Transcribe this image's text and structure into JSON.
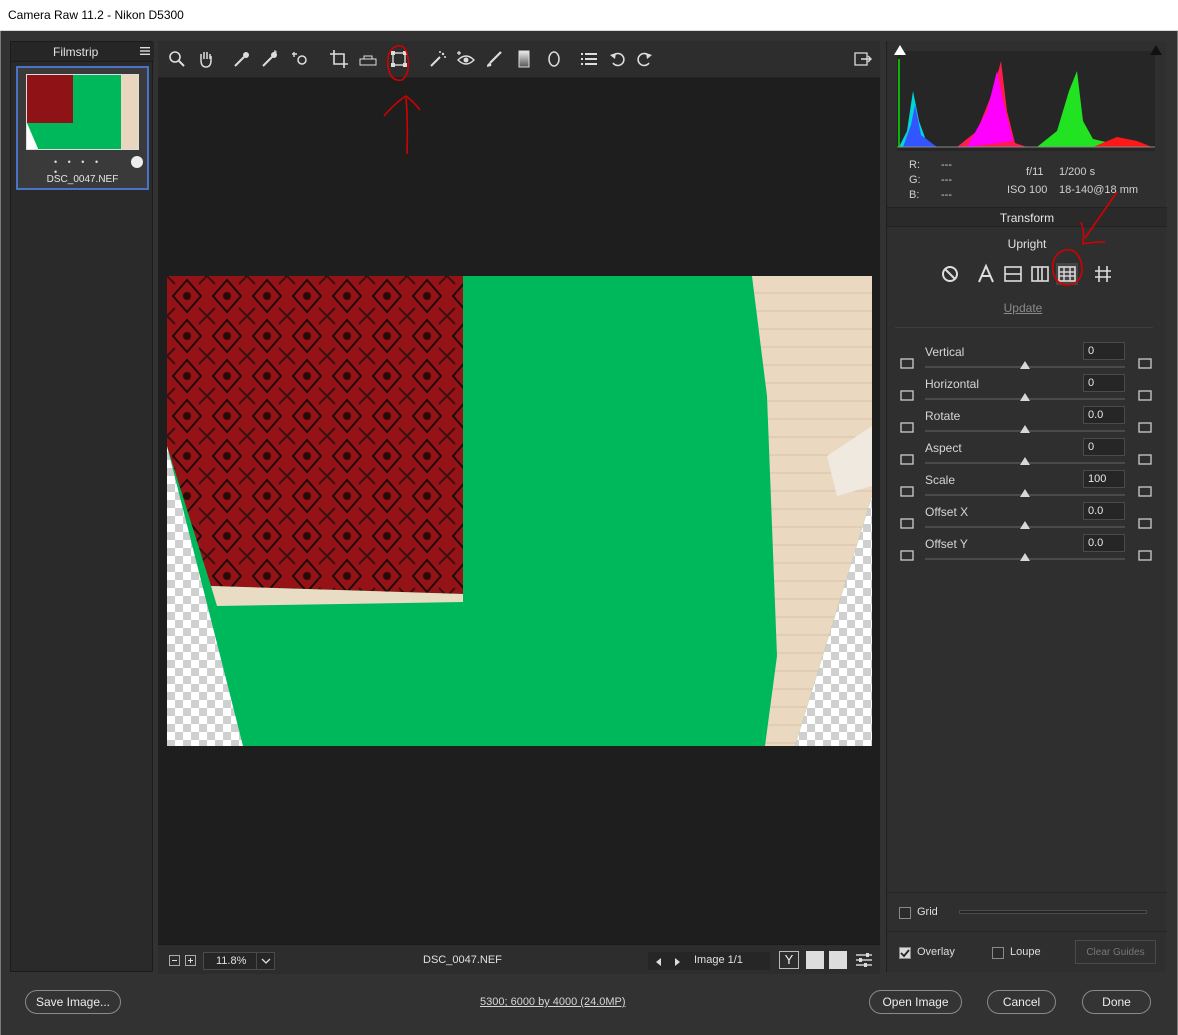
{
  "window": {
    "title": "Camera Raw 11.2  -  Nikon D5300"
  },
  "filmstrip": {
    "label": "Filmstrip",
    "items": [
      {
        "name": "DSC_0047.NEF",
        "rating_dots": "• • • • •"
      }
    ]
  },
  "toolbar": {
    "tools": [
      "zoom-icon",
      "hand-icon",
      "white-balance-icon",
      "color-sampler-icon",
      "targeted-adjustment-icon",
      "crop-icon",
      "straighten-icon",
      "transform-icon",
      "spot-removal-icon",
      "red-eye-icon",
      "adjustment-brush-icon",
      "graduated-filter-icon",
      "radial-filter-icon",
      "preferences-list-icon",
      "rotate-left-icon",
      "rotate-right-icon"
    ],
    "active_tool": "transform-icon"
  },
  "canvas_status": {
    "zoom_value": "11.8%",
    "filename": "DSC_0047.NEF",
    "image_counter": "Image 1/1"
  },
  "histogram": {
    "r_label": "R:",
    "g_label": "G:",
    "b_label": "B:",
    "r_value": "---",
    "g_value": "---",
    "b_value": "---",
    "aperture": "f/11",
    "shutter": "1/200 s",
    "iso": "ISO 100",
    "lens": "18-140@18 mm"
  },
  "panel": {
    "section_title": "Transform",
    "upright_label": "Upright",
    "upright_modes": [
      "off-icon",
      "auto-icon",
      "level-icon",
      "vertical-icon",
      "full-icon",
      "guided-icon"
    ],
    "upright_selected": "full-icon",
    "update_label": "Update",
    "sliders": [
      {
        "label": "Vertical",
        "value": "0",
        "position": 0.5
      },
      {
        "label": "Horizontal",
        "value": "0",
        "position": 0.5
      },
      {
        "label": "Rotate",
        "value": "0.0",
        "position": 0.5
      },
      {
        "label": "Aspect",
        "value": "0",
        "position": 0.5
      },
      {
        "label": "Scale",
        "value": "100",
        "position": 0.5
      },
      {
        "label": "Offset X",
        "value": "0.0",
        "position": 0.5
      },
      {
        "label": "Offset Y",
        "value": "0.0",
        "position": 0.5
      }
    ],
    "grid_label": "Grid",
    "overlay_label": "Overlay",
    "loupe_label": "Loupe",
    "clear_guides_label": "Clear Guides",
    "overlay_checked": true,
    "loupe_checked": false,
    "grid_checked": false
  },
  "footer": {
    "save_label": "Save Image...",
    "workflow_link": "5300; 6000 by 4000 (24.0MP)",
    "open_label": "Open Image",
    "cancel_label": "Cancel",
    "done_label": "Done"
  },
  "colors": {
    "accent": "#4a72c6",
    "annotation": "#d40000",
    "green_screen": "#00b85c",
    "carpet": "#9a1418"
  }
}
